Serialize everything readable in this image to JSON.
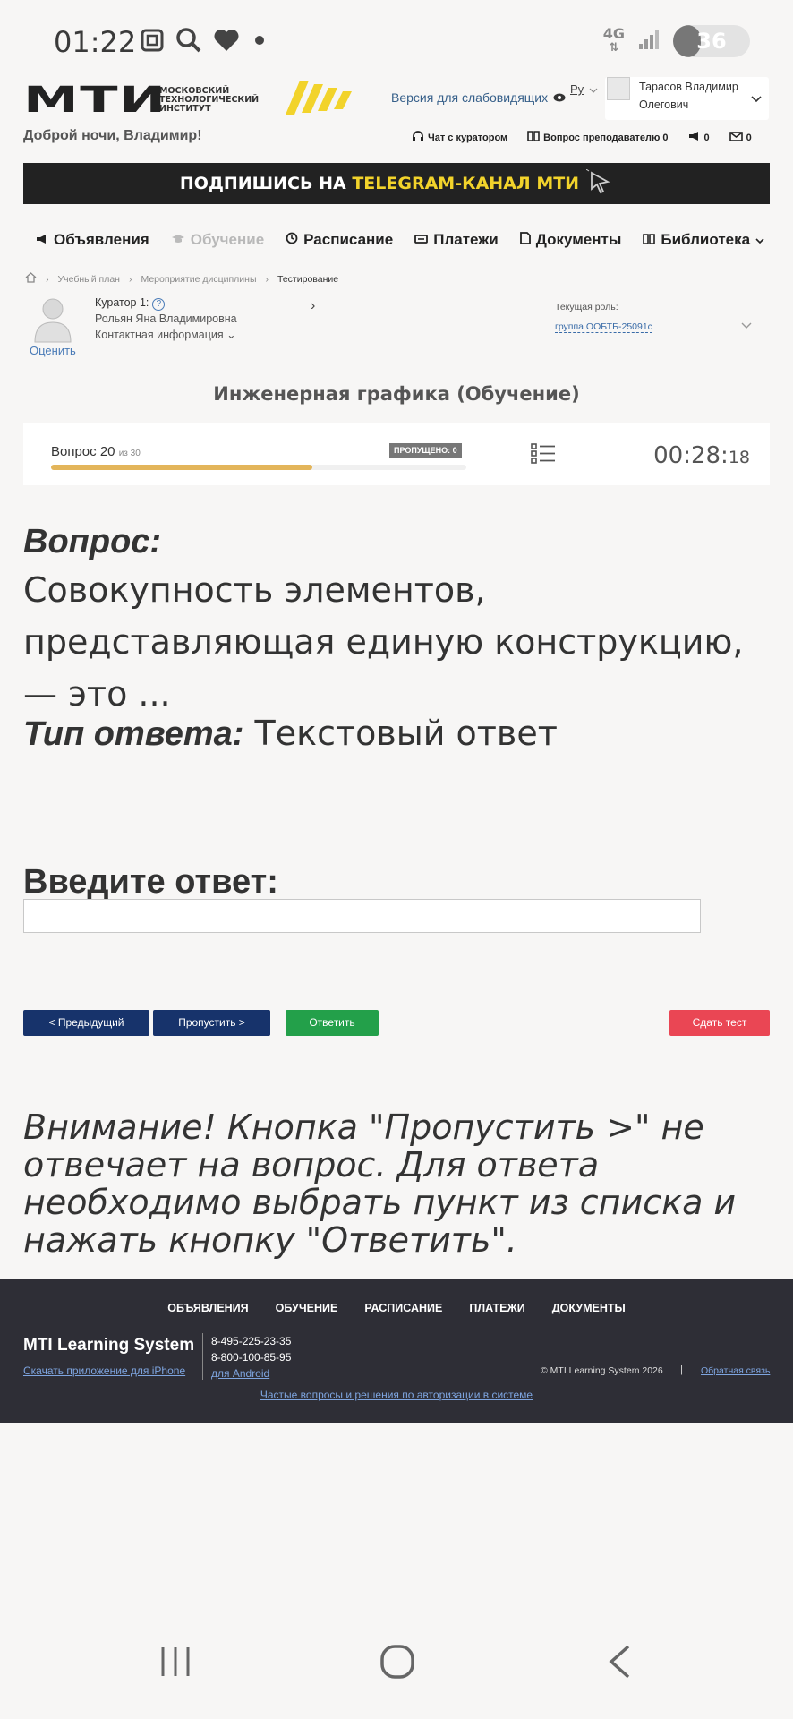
{
  "status_bar": {
    "time": "01:22",
    "network": "4G",
    "battery": "36",
    "battery_level": 0.36
  },
  "header": {
    "logo_text": "МТИ",
    "logo_subtitle": "МОСКОВСКИЙ ТЕХНОЛОГИЧЕСКИЙ ИНСТИТУТ",
    "low_vision_link": "Версия для слабовидящих",
    "language": "Ру",
    "user_name": "Тарасов Владимир Олегович",
    "greeting": "Доброй ночи, Владимир!",
    "quick_links": {
      "chat": "Чат с куратором",
      "question": "Вопрос преподавателю 0",
      "announcements_count": "0",
      "messages_count": "0"
    },
    "telegram_banner": {
      "white_part": "ПОДПИШИСЬ НА ",
      "yellow_part": "TELEGRAM-КАНАЛ МТИ"
    }
  },
  "main_nav": {
    "announcements": "Объявления",
    "learning": "Обучение",
    "schedule": "Расписание",
    "payments": "Платежи",
    "documents": "Документы",
    "library": "Библиотека"
  },
  "breadcrumb": {
    "plan": "Учебный план",
    "event": "Мероприятие дисциплины",
    "current": "Тестирование"
  },
  "curator": {
    "label": "Куратор 1:",
    "name": "Рольян Яна Владимировна",
    "contact": "Контактная информация",
    "rate": "Оценить"
  },
  "role": {
    "label": "Текущая роль:",
    "value": "группа ООБТБ-25091с"
  },
  "course_title": "Инженерная графика (Обучение)",
  "progress": {
    "question_label": "Вопрос 20",
    "of_total": "из 30",
    "skipped": "ПРОПУЩЕНО: 0",
    "fraction": 0.63,
    "timer_main": "00:28:",
    "timer_seconds": "18"
  },
  "question": {
    "label": "Вопрос:",
    "text": "Совокупность элементов, представляющая единую конструкцию, — это ...",
    "type_label": "Тип ответа:",
    "type_value": " Текстовый ответ",
    "answer_label": "Введите ответ:",
    "answer_value": ""
  },
  "buttons": {
    "prev": "< Предыдущий",
    "skip": "Пропустить >",
    "answer": "Ответить",
    "submit": "Сдать тест"
  },
  "warning": "Внимание! Кнопка \"Пропустить >\" не отвечает на вопрос. Для ответа необходимо выбрать пункт из списка и нажать кнопку \"Ответить\".",
  "footer": {
    "nav": [
      "ОБЪЯВЛЕНИЯ",
      "ОБУЧЕНИЕ",
      "РАСПИСАНИЕ",
      "ПЛАТЕЖИ",
      "ДОКУМЕНТЫ"
    ],
    "brand": "MTI Learning System",
    "iphone": "Скачать приложение для iPhone",
    "phone1": "8-495-225-23-35",
    "phone2": "8-800-100-85-95",
    "android": "для Android",
    "copyright": "© MTI Learning System 2026",
    "separator": "|",
    "feedback": "Обратная связь",
    "faq": "Частые вопросы и решения по авторизации в системе"
  },
  "colors": {
    "accent_blue": "#17336b",
    "answer_green": "#23a04a",
    "submit_red": "#ea4654",
    "progress": "#e3b55a",
    "footer_bg": "#2e2e36"
  },
  "icons": [
    "screenshot-icon",
    "search-icon",
    "heart-icon",
    "dot-icon",
    "signal-icon",
    "eye-icon",
    "headset-icon",
    "book-icon",
    "megaphone-icon",
    "envelope-icon",
    "cursor-icon",
    "graduation-cap-icon",
    "clock-icon",
    "card-icon",
    "document-icon",
    "home-icon",
    "list-icon",
    "recent-apps-icon",
    "home-button-icon",
    "back-icon"
  ]
}
